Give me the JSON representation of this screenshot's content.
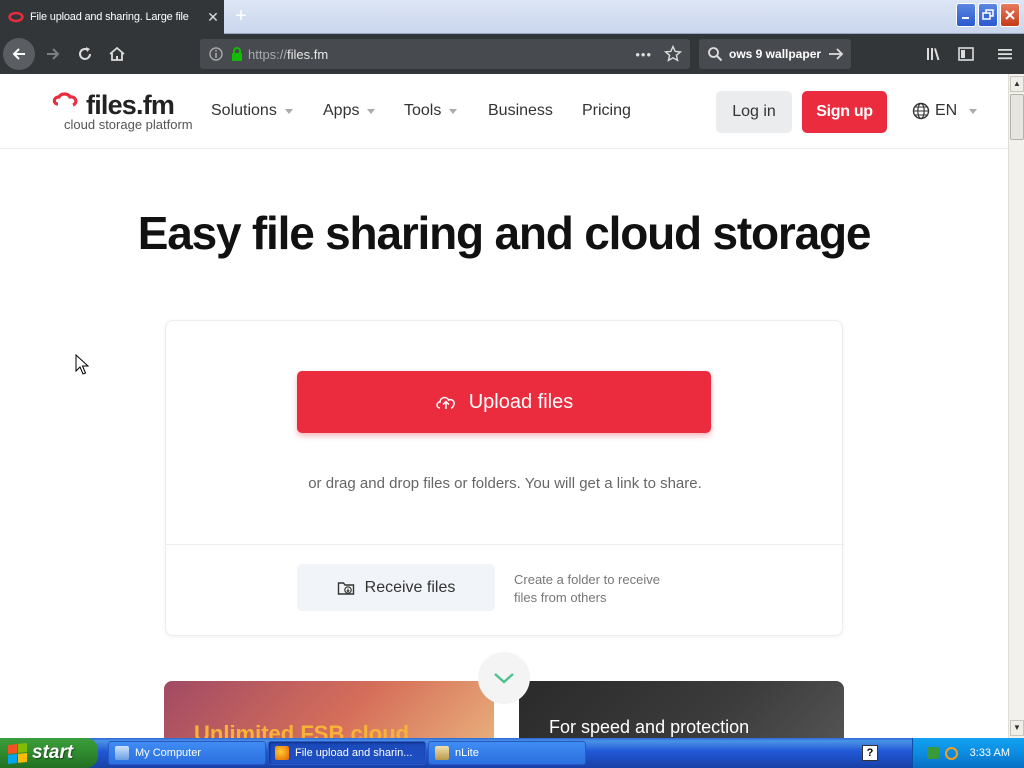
{
  "browser": {
    "tab_title": "File upload and sharing. Large file",
    "new_tab_symbol": "+",
    "url_protocol": "https://",
    "url_host": "files.fm",
    "search_query": "ows 9 wallpaper",
    "page_actions_symbol": "•••"
  },
  "site": {
    "logo_brand": "files.fm",
    "logo_tagline": "cloud storage platform",
    "nav": [
      {
        "label": "Solutions",
        "has_caret": true
      },
      {
        "label": "Apps",
        "has_caret": true
      },
      {
        "label": "Tools",
        "has_caret": true
      },
      {
        "label": "Business",
        "has_caret": false
      },
      {
        "label": "Pricing",
        "has_caret": false
      }
    ],
    "login_label": "Log in",
    "signup_label": "Sign up",
    "language": "EN",
    "accent_color": "#ea2c3e"
  },
  "hero": {
    "title": "Easy file sharing and cloud storage",
    "upload_label": "Upload files",
    "drag_hint": "or drag and drop files or folders. You will get a link to share.",
    "receive_label": "Receive files",
    "receive_description": "Create a folder to receive files from others"
  },
  "promos": [
    {
      "title": "Unlimited FSB cloud"
    },
    {
      "title": "For speed and protection"
    }
  ],
  "taskbar": {
    "start_label": "start",
    "tasks": [
      {
        "label": "My Computer",
        "active": false
      },
      {
        "label": "File upload and sharin...",
        "active": true
      },
      {
        "label": "nLite",
        "active": false
      }
    ],
    "help_symbol": "?",
    "clock": "3:33 AM"
  }
}
